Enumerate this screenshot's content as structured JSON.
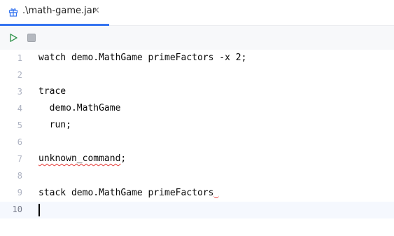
{
  "tab": {
    "label": ".\\math-game.jar",
    "close_glyph": "✕",
    "icon": "gift-icon",
    "accent_color": "#3574f0"
  },
  "toolbar": {
    "run_icon": "run-icon",
    "stop_icon": "stop-icon",
    "run_color": "#369650"
  },
  "editor": {
    "current_line": 10,
    "lines": [
      {
        "num": "1",
        "text": "watch demo.MathGame primeFactors -x 2;"
      },
      {
        "num": "2",
        "text": ""
      },
      {
        "num": "3",
        "text": "trace"
      },
      {
        "num": "4",
        "text": "  demo.MathGame"
      },
      {
        "num": "5",
        "text": "  run;"
      },
      {
        "num": "6",
        "text": ""
      },
      {
        "num": "7",
        "text": "unknown_command",
        "suffix": ";",
        "error": true
      },
      {
        "num": "8",
        "text": ""
      },
      {
        "num": "9",
        "text": "stack demo.MathGame primeFactors"
      },
      {
        "num": "10",
        "text": ""
      }
    ]
  }
}
